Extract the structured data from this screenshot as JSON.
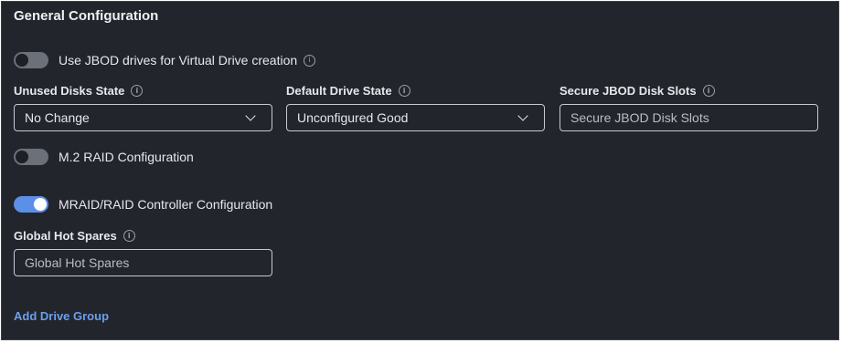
{
  "section": {
    "title": "General Configuration"
  },
  "toggles": {
    "jbod": {
      "label": "Use JBOD drives for Virtual Drive creation",
      "state": "off"
    },
    "m2_raid": {
      "label": "M.2 RAID Configuration",
      "state": "off"
    },
    "mraid": {
      "label": "MRAID/RAID Controller Configuration",
      "state": "on"
    }
  },
  "fields": {
    "unused_disks_state": {
      "label": "Unused Disks State",
      "value": "No Change"
    },
    "default_drive_state": {
      "label": "Default Drive State",
      "value": "Unconfigured Good"
    },
    "secure_jbod_disk_slots": {
      "label": "Secure JBOD Disk Slots",
      "placeholder": "Secure JBOD Disk Slots"
    },
    "global_hot_spares": {
      "label": "Global Hot Spares",
      "placeholder": "Global Hot Spares"
    }
  },
  "actions": {
    "add_drive_group": "Add Drive Group"
  },
  "icons": {
    "info": "info-icon",
    "info_glyph": "i",
    "dropdown": "chevron-down-icon"
  },
  "colors": {
    "background": "#22252b",
    "accent": "#5b8fe8",
    "link": "#6d9fec"
  }
}
